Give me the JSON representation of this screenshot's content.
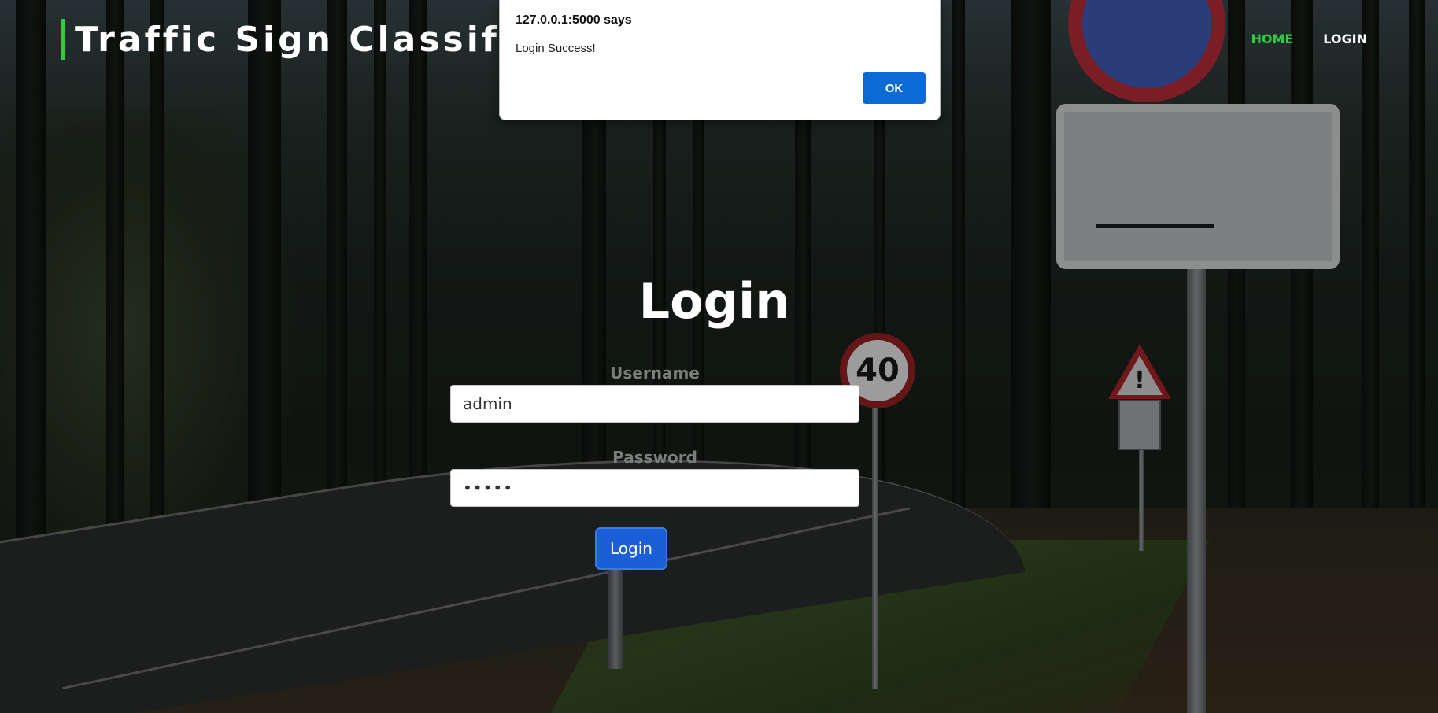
{
  "header": {
    "brand_title": "Traffic Sign Classification",
    "nav": [
      {
        "label": "HOME",
        "active": true
      },
      {
        "label": "LOGIN",
        "active": false
      }
    ]
  },
  "login": {
    "title": "Login",
    "username_label": "Username",
    "username_value": "admin",
    "password_label": "Password",
    "password_value": "•••••",
    "button_label": "Login"
  },
  "alert": {
    "title": "127.0.0.1:5000 says",
    "message": "Login Success!",
    "ok_label": "OK"
  },
  "background": {
    "speed_sign_text": "40"
  },
  "colors": {
    "accent_green": "#2ecc40",
    "button_blue": "#1a5fd8",
    "alert_ok_blue": "#0b6ad6"
  }
}
